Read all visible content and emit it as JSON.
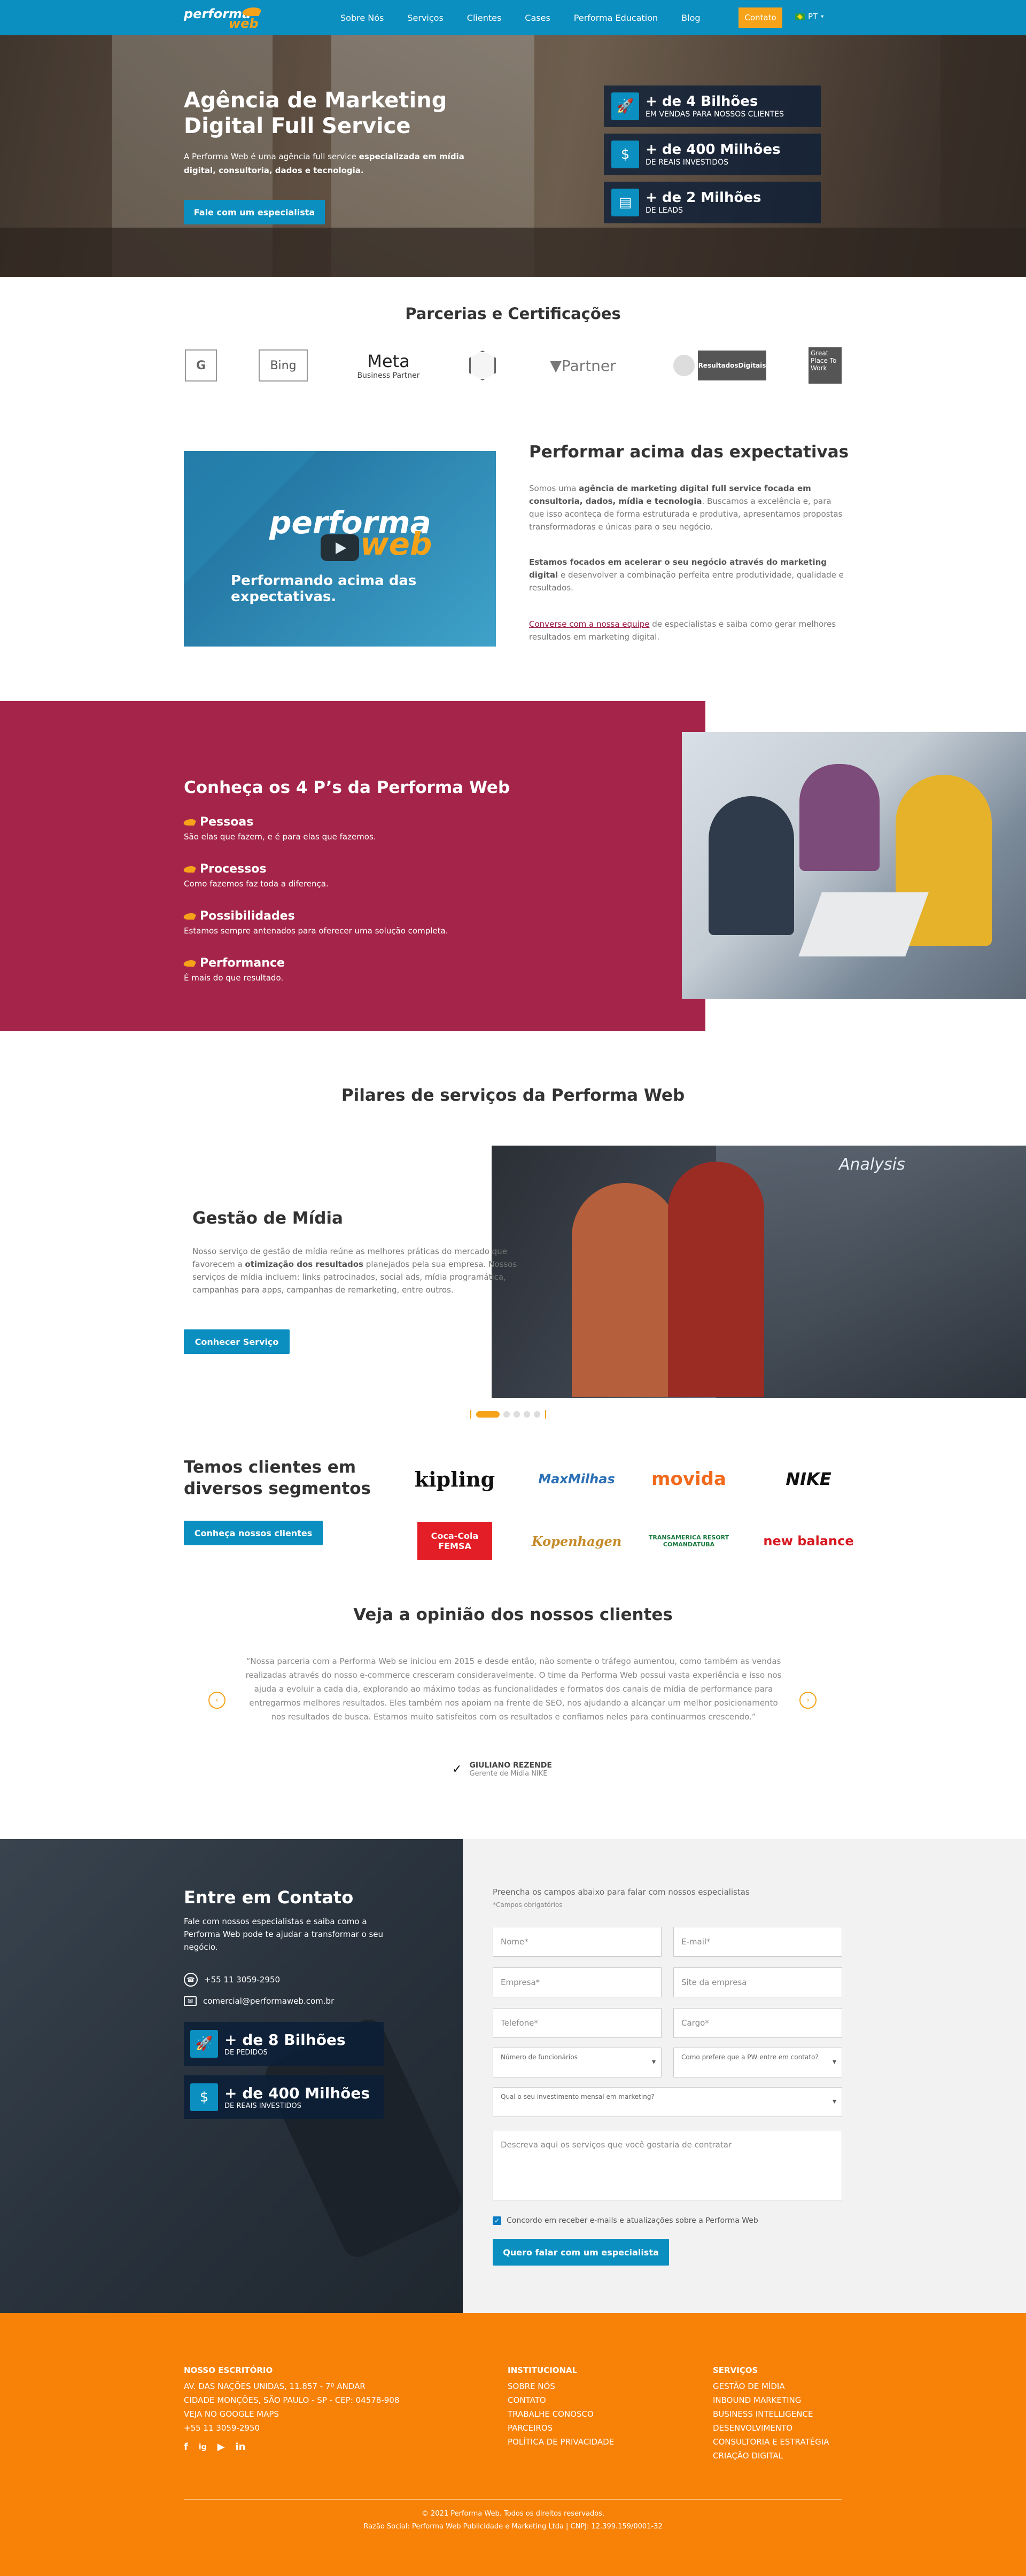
{
  "nav": {
    "logo_a": "performa",
    "logo_b": "web",
    "items": [
      "Sobre Nós",
      "Serviços",
      "Clientes",
      "Cases",
      "Performa Education",
      "Blog"
    ],
    "contact": "Contato",
    "lang": "PT"
  },
  "hero": {
    "title": "Agência de Marketing Digital Full Service",
    "desc_a": "A Performa Web é uma agência full service ",
    "desc_b": "especializada em mídia digital, consultoria, dados e tecnologia.",
    "cta": "Fale com um especialista",
    "stats": [
      {
        "icon": "rocket-icon",
        "big": "+ de 4 Bilhões",
        "small": "EM VENDAS PARA NOSSOS CLIENTES"
      },
      {
        "icon": "dollar-icon",
        "big": "+ de 400 Milhões",
        "small": "DE REAIS INVESTIDOS"
      },
      {
        "icon": "document-icon",
        "big": "+ de 2 Milhões",
        "small": "DE LEADS"
      }
    ]
  },
  "partners": {
    "title": "Parcerias e Certificações",
    "logos": [
      "G",
      "Bing",
      "Meta",
      "Business Partner",
      "Partner",
      "ResultadosDigitais",
      "Great Place To Work"
    ]
  },
  "intro": {
    "video_a": "performa",
    "video_b": "web",
    "video_caption": "Performando acima das expectativas.",
    "title": "Performar acima das expectativas",
    "p1_a": "Somos uma ",
    "p1_b": "agência de marketing digital full service focada em consultoria, dados, mídia e tecnologia",
    "p1_c": ". Buscamos a excelência e, para que isso aconteça de forma estruturada e produtiva, apresentamos propostas transformadoras e únicas para o seu negócio.",
    "p2_a": "Estamos focados em acelerar o seu negócio através do marketing digital",
    "p2_b": " e desenvolver a combinação perfeita entre produtividade, qualidade e resultados.",
    "p3_a": "Converse com a nossa equipe",
    "p3_b": " de especialistas e saiba como gerar melhores resultados em marketing digital."
  },
  "fourp": {
    "title": "Conheça os 4 P’s da Performa Web",
    "items": [
      {
        "h": "Pessoas",
        "d": "São elas que fazem, e é para elas que fazemos."
      },
      {
        "h": "Processos",
        "d": "Como fazemos faz toda a diferença."
      },
      {
        "h": "Possibilidades",
        "d": "Estamos sempre antenados para oferecer uma solução completa."
      },
      {
        "h": "Performance",
        "d": "É mais do que resultado."
      }
    ]
  },
  "pilares": {
    "title": "Pilares de serviços da Performa Web",
    "slide_title": "Gestão de Mídia",
    "img_label": "Analysis",
    "desc_a": "Nosso serviço de gestão de mídia reúne as melhores práticas do mercado que favorecem a ",
    "desc_b": "otimização dos resultados",
    "desc_c": " planejados pela sua empresa. Nossos serviços de mídia incluem: links patrocinados, social ads, mídia programática, campanhas para apps, campanhas de remarketing, entre outros.",
    "cta": "Conhecer Serviço",
    "slides_total": 5,
    "slide_active": 1
  },
  "clientes": {
    "title": "Temos clientes em diversos segmentos",
    "cta": "Conheça nossos clientes",
    "logos": [
      "kipling",
      "MaxMilhas",
      "movida",
      "NIKE",
      "Coca-Cola FEMSA",
      "Kopenhagen",
      "TRANSAMERICA RESORT COMANDATUBA",
      "new balance"
    ]
  },
  "opiniao": {
    "title": "Veja a opinião dos nossos clientes",
    "quote": "“Nossa parceria com a Performa Web se iniciou em 2015 e desde então, não somente o tráfego aumentou, como também as vendas realizadas através do nosso e-commerce cresceram consideravelmente. O time da Performa Web possui vasta experiência e isso nos ajuda a evoluir a cada dia, explorando ao máximo todas as funcionalidades e formatos dos canais de mídia de performance para entregarmos melhores resultados. Eles também nos apoiam na frente de SEO, nos ajudando a alcançar um melhor posicionamento nos resultados de busca. Estamos muito satisfeitos com os resultados e confiamos neles para continuarmos crescendo.”",
    "author": "GIULIANO REZENDE",
    "role": "Gerente de Mídia NIKE",
    "prev": "‹",
    "next": "›"
  },
  "contato": {
    "title": "Entre em Contato",
    "text": "Fale com nossos especialistas e saiba como a Performa Web pode te ajudar a transformar o seu negócio.",
    "phone": "+55 11 3059-2950",
    "email": "comercial@performaweb.com.br",
    "stats": [
      {
        "icon": "rocket-icon",
        "big": "+ de 8 Bilhões",
        "small": "DE PEDIDOS"
      },
      {
        "icon": "dollar-icon",
        "big": "+ de 400 Milhões",
        "small": "DE REAIS INVESTIDOS"
      }
    ],
    "form_title": "Preencha os campos abaixo para falar com nossos especialistas",
    "required_note": "*Campos obrigatórios",
    "fields": {
      "nome": "Nome*",
      "email": "E-mail*",
      "empresa": "Empresa*",
      "site": "Site da empresa",
      "telefone": "Telefone*",
      "cargo": "Cargo*",
      "funcionarios": "Número de funcionários",
      "preferencia": "Como prefere que a PW entre em contato?",
      "investimento": "Qual o seu investimento mensal em marketing?",
      "servicos": "Descreva aqui os serviços que você gostaria de contratar"
    },
    "consent": "Concordo em receber e-mails e atualizações sobre a Performa Web",
    "consent_checked": true,
    "submit": "Quero falar com um especialista"
  },
  "footer": {
    "office_title": "NOSSO ESCRITÓRIO",
    "office_lines": [
      "AV. DAS NAÇÕES UNIDAS, 11.857 - 7º ANDAR",
      "CIDADE MONÇÕES, SÃO PAULO - SP - CEP: 04578-908",
      "VEJA NO GOOGLE MAPS",
      "+55 11 3059-2950"
    ],
    "inst_title": "INSTITUCIONAL",
    "inst_links": [
      "SOBRE NÓS",
      "CONTATO",
      "TRABALHE CONOSCO",
      "PARCEIROS",
      "POLÍTICA DE PRIVACIDADE"
    ],
    "serv_title": "SERVIÇOS",
    "serv_links": [
      "GESTÃO DE MÍDIA",
      "INBOUND MARKETING",
      "BUSINESS INTELLIGENCE",
      "DESENVOLVIMENTO",
      "CONSULTORIA E ESTRATÉGIA",
      "CRIAÇÃO DIGITAL"
    ],
    "social": [
      "f",
      "ig",
      "▶",
      "in"
    ],
    "copyright": "© 2021 Performa Web. Todos os direitos reservados.",
    "legal": "Razão Social: Performa Web Publicidade e Marketing Ltda | CNPJ: 12.399.159/0001-32"
  },
  "colors": {
    "primary": "#0a8fc0",
    "accent": "#f6a31a",
    "wine": "#a5254a",
    "footer": "#f88208"
  }
}
